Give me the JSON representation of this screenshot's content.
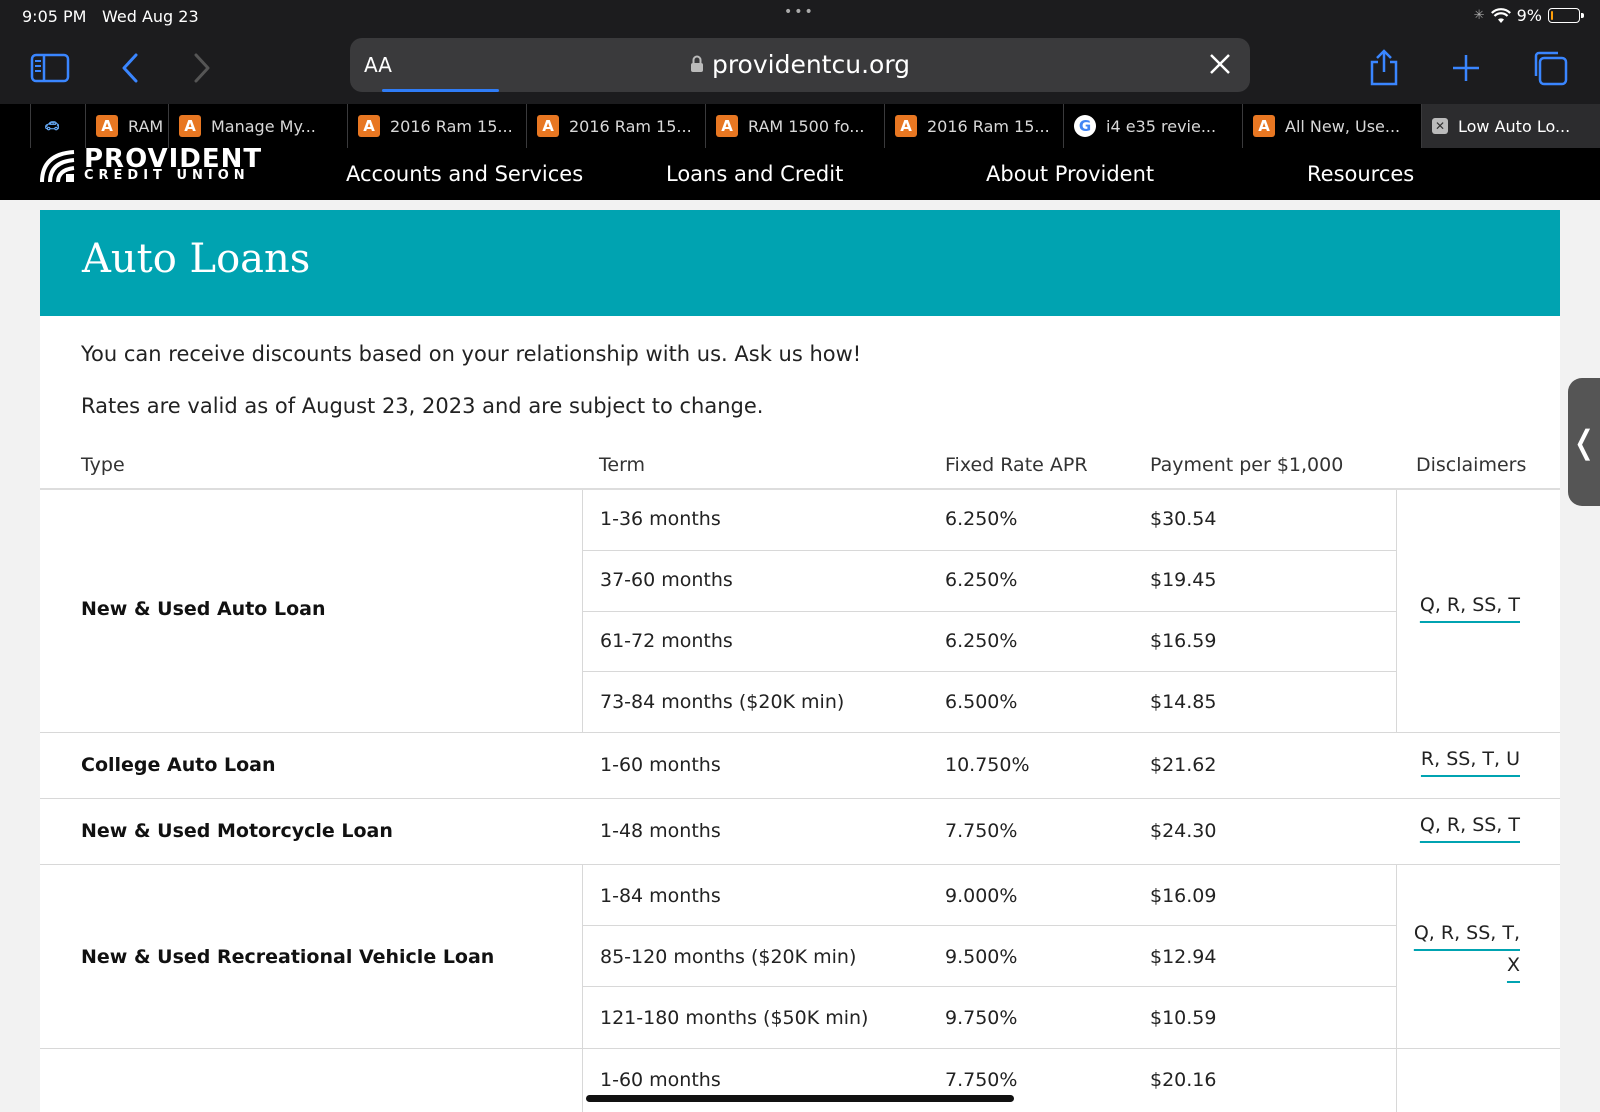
{
  "status_bar": {
    "time": "9:05 PM",
    "date": "Wed Aug 23",
    "dots": "•••",
    "battery": "9%",
    "battery_level": 0.09
  },
  "browser": {
    "text_size_label": "AA",
    "url": "providentcu.org",
    "load_progress": 0.13,
    "tabs": [
      {
        "label": "",
        "icon": "car-icon"
      },
      {
        "label": "RAM",
        "icon": "autotrader-icon"
      },
      {
        "label": "Manage My...",
        "icon": "autotrader-icon"
      },
      {
        "label": "2016 Ram 15...",
        "icon": "autotrader-icon"
      },
      {
        "label": "2016 Ram 15...",
        "icon": "autotrader-icon"
      },
      {
        "label": "RAM 1500 fo...",
        "icon": "autotrader-icon"
      },
      {
        "label": "2016 Ram 15...",
        "icon": "autotrader-icon"
      },
      {
        "label": "i4 e35 revie...",
        "icon": "google-icon"
      },
      {
        "label": "All New, Use...",
        "icon": "autotrader-icon"
      },
      {
        "label": "Low Auto Lo...",
        "icon": "close-tab-icon"
      }
    ]
  },
  "site": {
    "logo_brand": "PROVIDENT",
    "logo_sub": "CREDIT UNION",
    "nav": [
      "Accounts and Services",
      "Loans and Credit",
      "About Provident",
      "Resources"
    ]
  },
  "page": {
    "title": "Auto Loans",
    "intro1": "You can receive discounts based on your relationship with us. Ask us how!",
    "intro2": "Rates are valid as of August 23, 2023 and are subject to change."
  },
  "table": {
    "headers": {
      "type": "Type",
      "term": "Term",
      "apr": "Fixed Rate APR",
      "payment": "Payment per $1,000",
      "disclaimers": "Disclaimers"
    },
    "groups": [
      {
        "type": "New & Used Auto Loan",
        "disclaimers": "Q, R, SS, T",
        "rows": [
          {
            "term": "1-36 months",
            "apr": "6.250%",
            "payment": "$30.54"
          },
          {
            "term": "37-60 months",
            "apr": "6.250%",
            "payment": "$19.45"
          },
          {
            "term": "61-72 months",
            "apr": "6.250%",
            "payment": "$16.59"
          },
          {
            "term": "73-84 months ($20K min)",
            "apr": "6.500%",
            "payment": "$14.85"
          }
        ]
      },
      {
        "type": "College Auto Loan",
        "disclaimers": "R, SS, T, U",
        "rows": [
          {
            "term": "1-60 months",
            "apr": "10.750%",
            "payment": "$21.62"
          }
        ]
      },
      {
        "type": "New & Used Motorcycle Loan",
        "disclaimers": "Q, R, SS, T",
        "rows": [
          {
            "term": "1-48 months",
            "apr": "7.750%",
            "payment": "$24.30"
          }
        ]
      },
      {
        "type": "New & Used Recreational Vehicle Loan",
        "disclaimers": "Q, R, SS, T,",
        "disclaimers2": "X",
        "rows": [
          {
            "term": "1-84 months",
            "apr": "9.000%",
            "payment": "$16.09"
          },
          {
            "term": "85-120 months ($20K min)",
            "apr": "9.500%",
            "payment": "$12.94"
          },
          {
            "term": "121-180 months ($50K min)",
            "apr": "9.750%",
            "payment": "$10.59"
          }
        ]
      },
      {
        "type": "",
        "disclaimers": "",
        "rows": [
          {
            "term": "1-60 months",
            "apr": "7.750%",
            "payment": "$20.16"
          }
        ]
      }
    ]
  },
  "colors": {
    "accent": "#00a3b1",
    "ios_blue": "#3a86ff",
    "battery_low": "#ff9f0a"
  }
}
